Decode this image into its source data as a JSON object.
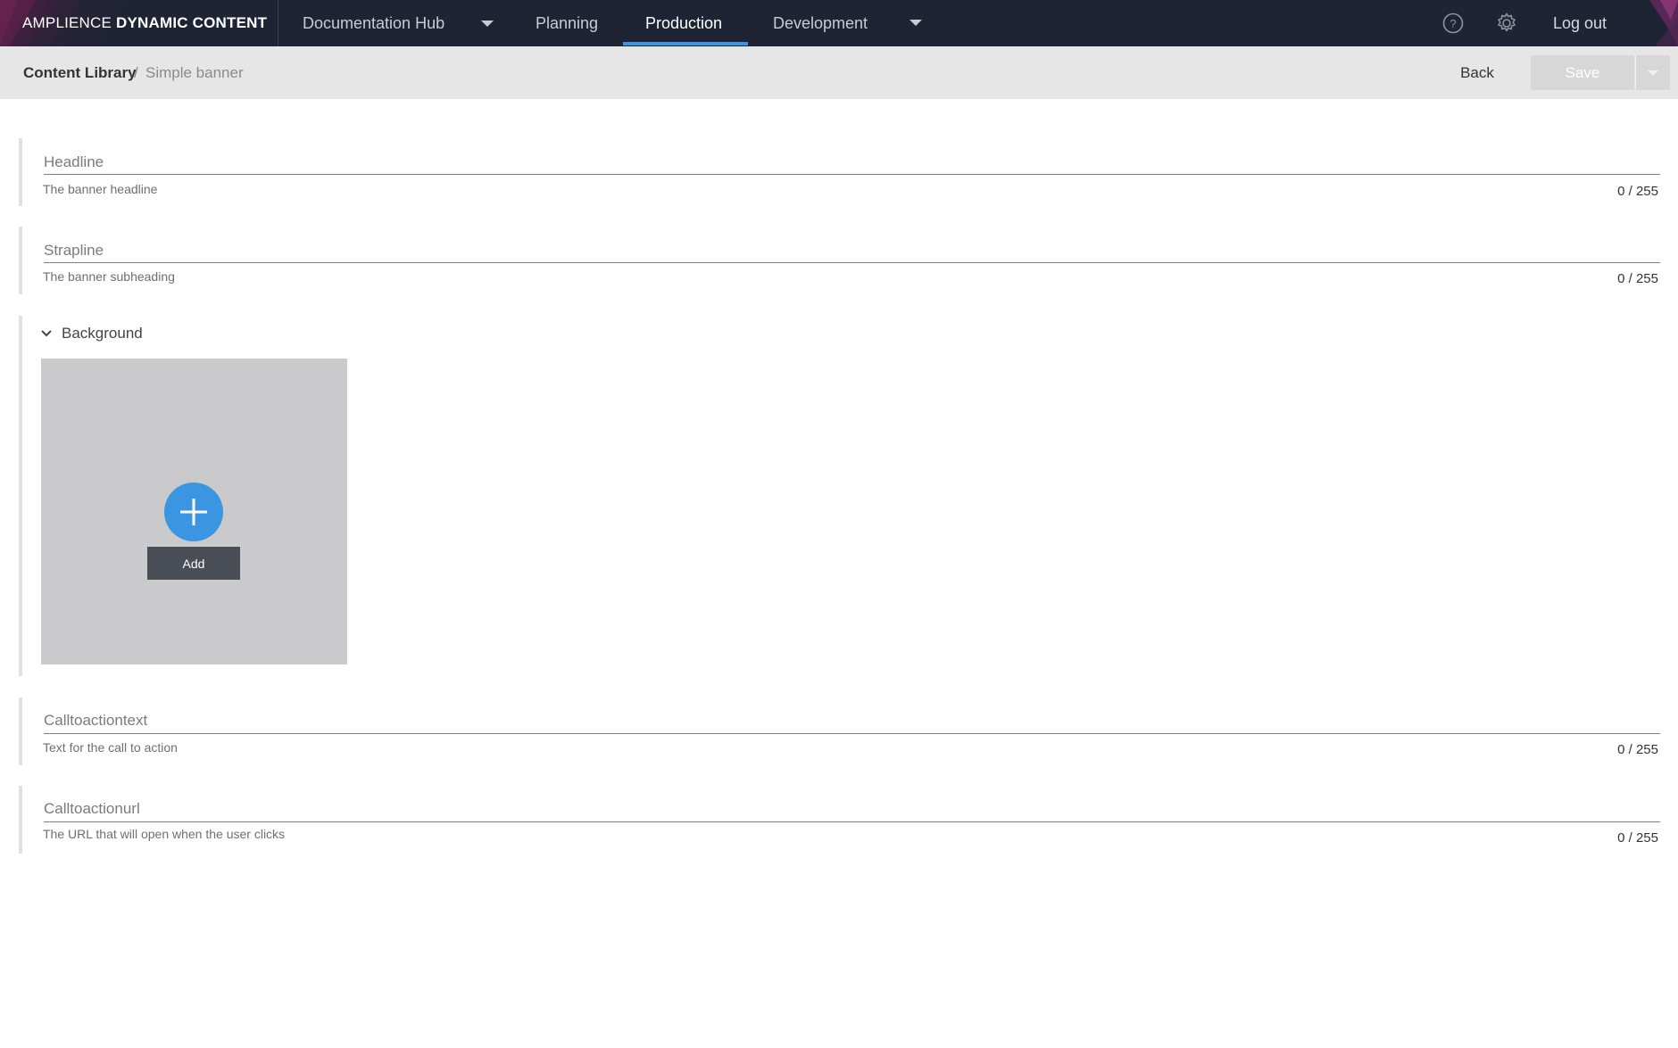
{
  "app": {
    "brand_light": "AMPLIENCE",
    "brand_bold": "DYNAMIC CONTENT"
  },
  "nav": {
    "hub": "Documentation Hub",
    "items": [
      {
        "label": "Planning"
      },
      {
        "label": "Production"
      },
      {
        "label": "Development"
      }
    ],
    "active": "Production",
    "help_icon": "help-icon",
    "settings_icon": "gear-icon",
    "logout": "Log out"
  },
  "breadcrumb": {
    "root": "Content Library",
    "separator": "/",
    "current": "Simple banner"
  },
  "actions": {
    "back": "Back",
    "save": "Save"
  },
  "form": {
    "headline": {
      "label": "Headline",
      "help": "The banner headline",
      "count": "0 / 255"
    },
    "strapline": {
      "label": "Strapline",
      "help": "The banner subheading",
      "count": "0 / 255"
    },
    "background": {
      "title": "Background",
      "add_label": "Add"
    },
    "calltoactiontext": {
      "label": "Calltoactiontext",
      "help": "Text for the call to action",
      "count": "0 / 255"
    },
    "calltoactionurl": {
      "label": "Calltoactionurl",
      "help": "The URL that will open when the user clicks",
      "count": "0 / 255"
    }
  },
  "colors": {
    "topbar": "#1e2433",
    "accent": "#3b95e0",
    "subbar": "#e6e6e6",
    "media_placeholder": "#cacacc"
  }
}
